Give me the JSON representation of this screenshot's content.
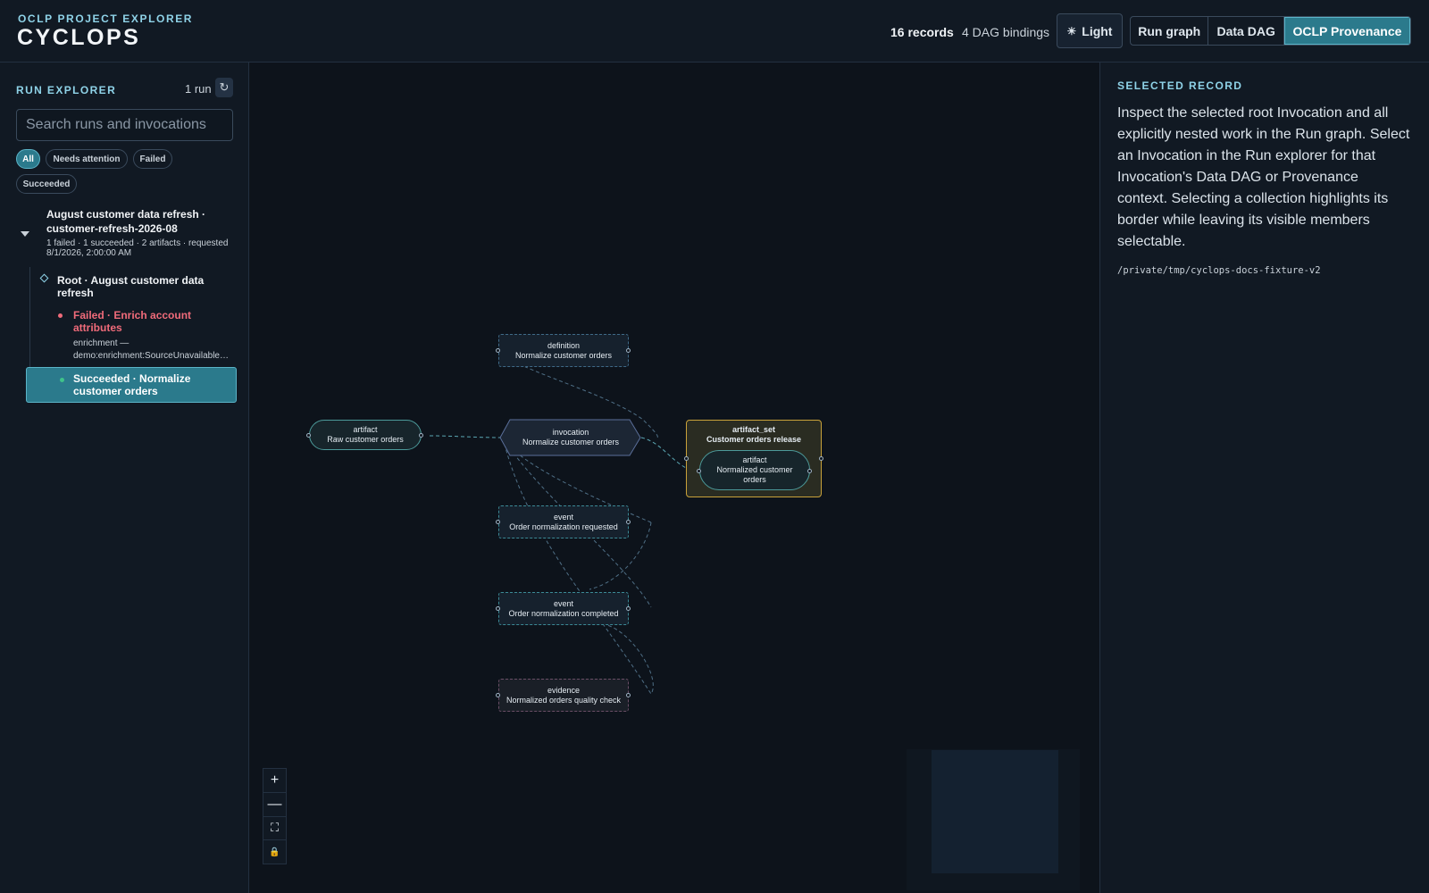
{
  "header": {
    "eyebrow": "OCLP PROJECT EXPLORER",
    "title": "CYCLOPS",
    "records": "16 records",
    "bindings": "4 DAG bindings",
    "theme_button": "Light",
    "views": [
      "Run graph",
      "Data DAG",
      "OCLP Provenance"
    ],
    "active_view": "OCLP Provenance"
  },
  "sidebar": {
    "title": "RUN EXPLORER",
    "run_count": "1 run",
    "search_placeholder": "Search runs and invocations",
    "filters": [
      "All",
      "Needs attention",
      "Failed",
      "Succeeded"
    ],
    "active_filter": "All",
    "run": {
      "title": "August customer data refresh · customer-refresh-2026-08",
      "meta": "1 failed · 1 succeeded · 2 artifacts · requested 8/1/2026, 2:00:00 AM",
      "root": "Root · August customer data refresh",
      "failed": {
        "label": "Failed · Enrich account attributes",
        "meta_line1": "enrichment —",
        "meta_line2": "demo:enrichment:SourceUnavailable…"
      },
      "succeeded": {
        "label": "Succeeded · Normalize customer orders"
      }
    }
  },
  "graph": {
    "nodes": {
      "definition": {
        "kind": "definition",
        "label": "Normalize customer orders"
      },
      "raw_artifact": {
        "kind": "artifact",
        "label": "Raw customer orders"
      },
      "invocation": {
        "kind": "invocation",
        "label": "Normalize customer orders"
      },
      "artifact_set": {
        "kind": "artifact_set",
        "label": "Customer orders release"
      },
      "norm_artifact": {
        "kind": "artifact",
        "label": "Normalized customer orders"
      },
      "event_requested": {
        "kind": "event",
        "label": "Order normalization requested"
      },
      "event_completed": {
        "kind": "event",
        "label": "Order normalization completed"
      },
      "evidence": {
        "kind": "evidence",
        "label": "Normalized orders quality check"
      }
    },
    "controls": {
      "zoom_in": "+",
      "zoom_out": "—",
      "fit": "⛶",
      "lock": "🔒"
    }
  },
  "panel": {
    "title": "SELECTED RECORD",
    "description": "Inspect the selected root Invocation and all explicitly nested work in the Run graph. Select an Invocation in the Run explorer for that Invocation's Data DAG or Provenance context. Selecting a collection highlights its border while leaving its visible members selectable.",
    "path": "/private/tmp/cyclops-docs-fixture-v2"
  },
  "colors": {
    "accent": "#8fd3e8",
    "active": "#2b7a8c",
    "failed": "#f06b7a",
    "succeeded": "#3fc38a",
    "artifact_set_border": "#c9a23a"
  }
}
